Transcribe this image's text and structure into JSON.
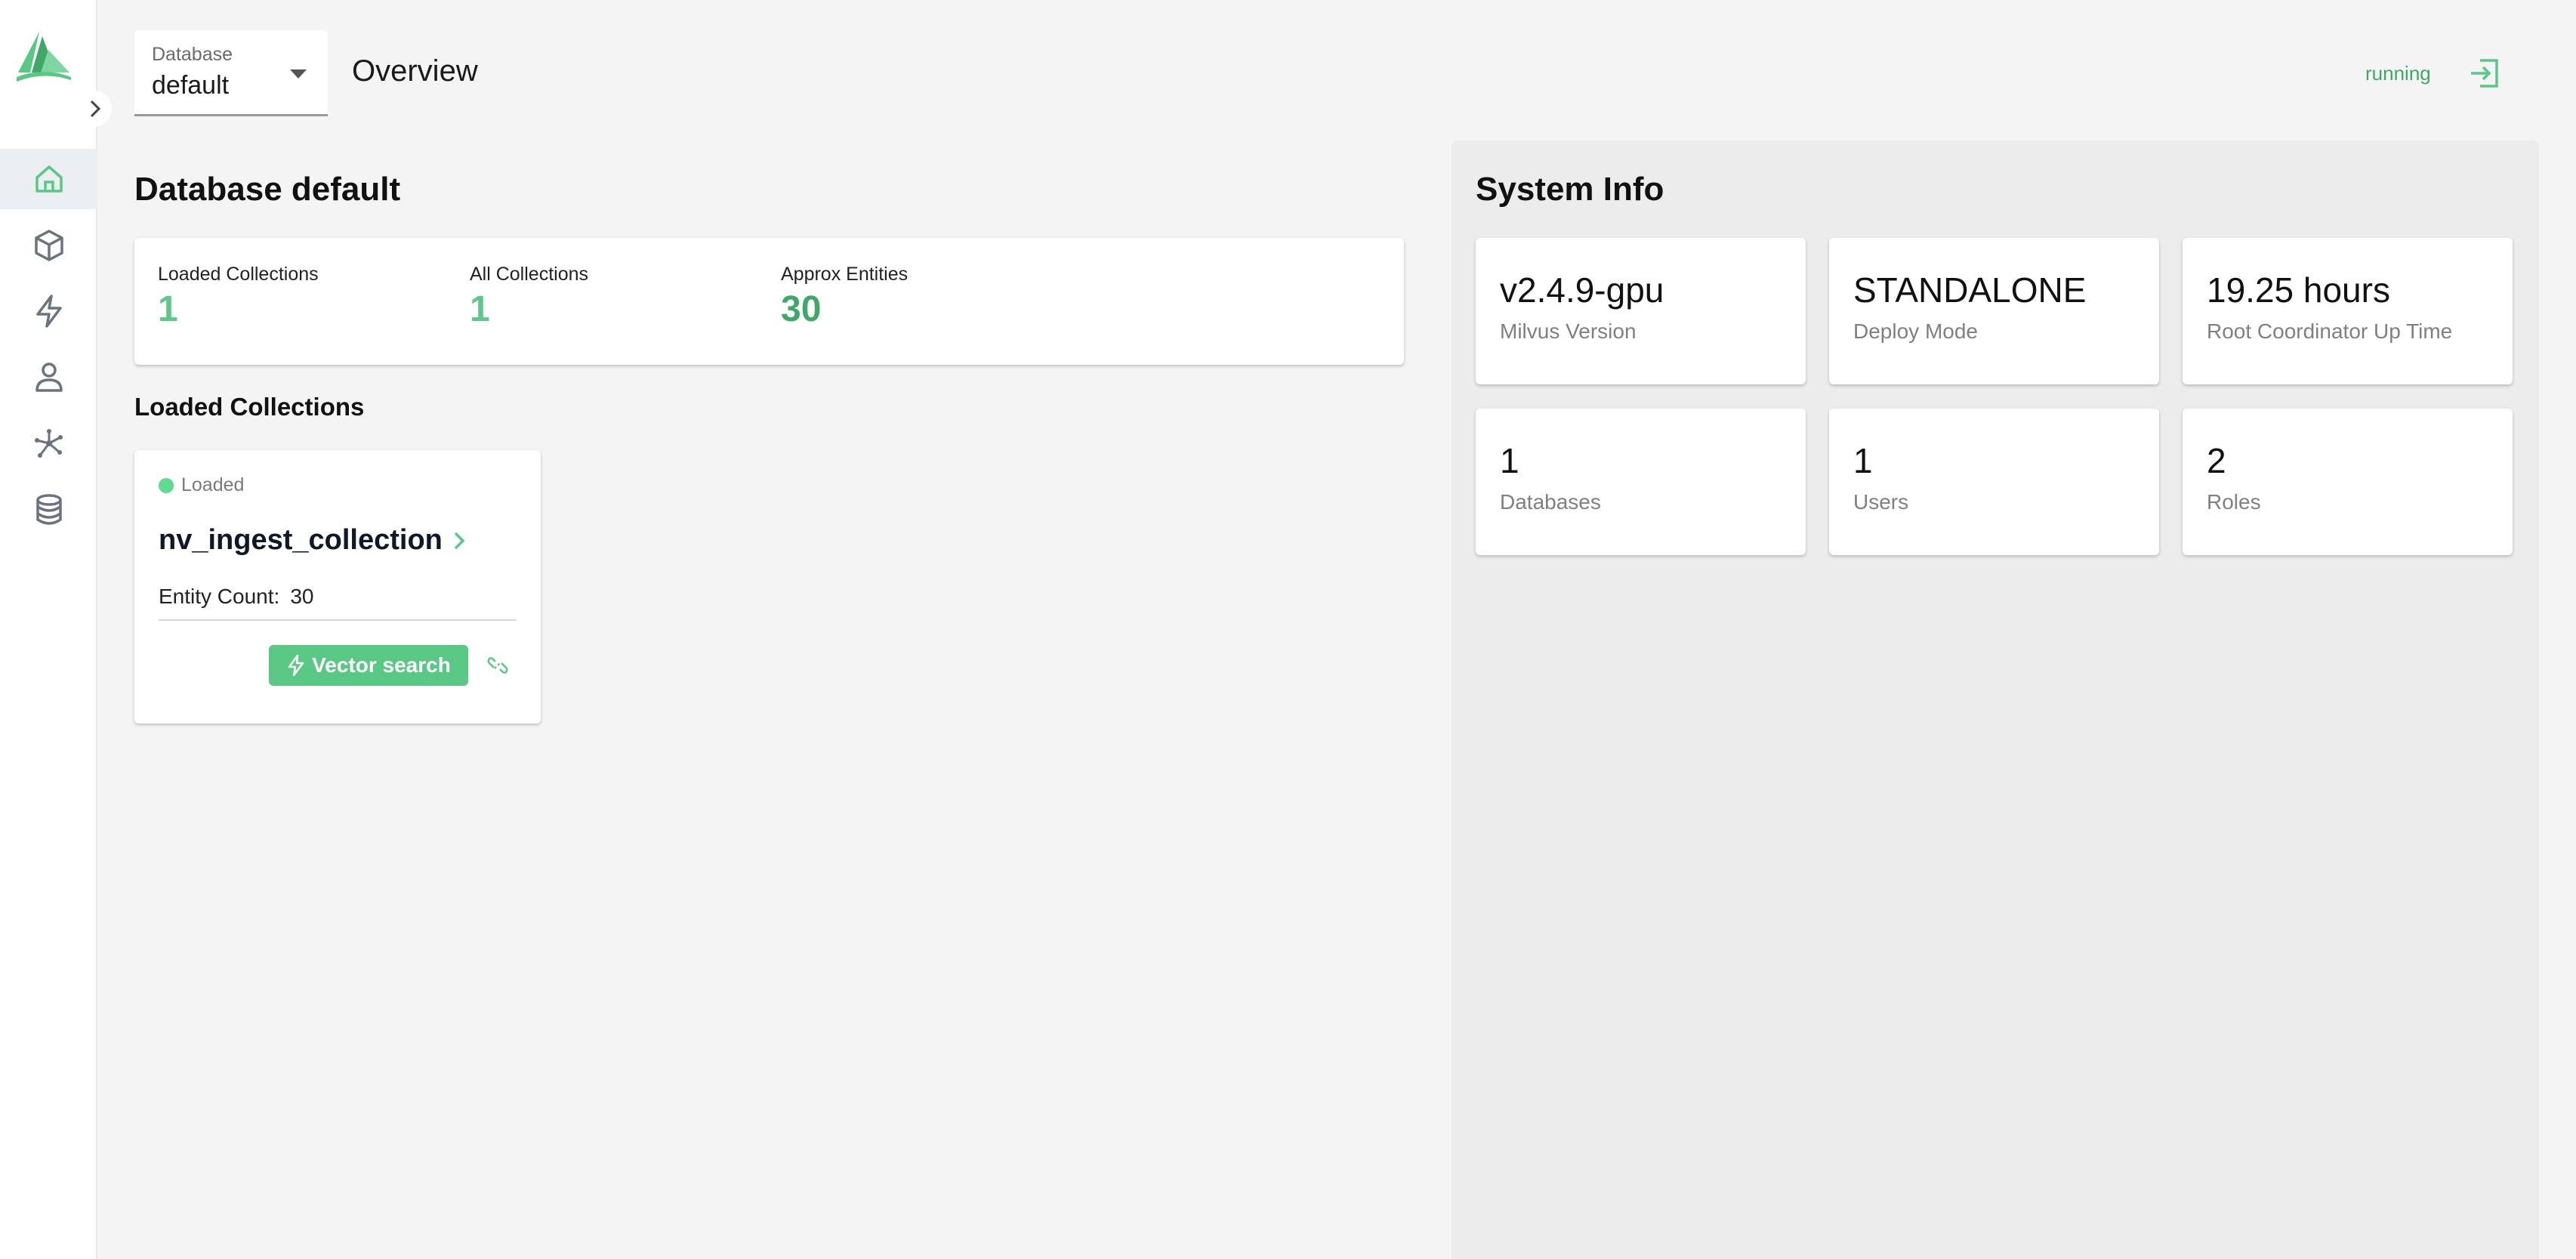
{
  "top_bar": {
    "database_label": "Database",
    "database_value": "default",
    "page_title": "Overview",
    "status": "running"
  },
  "database_section": {
    "title": "Database default",
    "stats": [
      {
        "label": "Loaded Collections",
        "value": "1"
      },
      {
        "label": "All Collections",
        "value": "1"
      },
      {
        "label": "Approx Entities",
        "value": "30"
      }
    ]
  },
  "loaded_collections": {
    "title": "Loaded Collections",
    "items": [
      {
        "status": "Loaded",
        "name": "nv_ingest_collection",
        "entity_count_label": "Entity Count:",
        "entity_count": "30",
        "action_label": "Vector search"
      }
    ]
  },
  "system_info": {
    "title": "System Info",
    "cards": [
      {
        "value": "v2.4.9-gpu",
        "label": "Milvus Version"
      },
      {
        "value": "STANDALONE",
        "label": "Deploy Mode"
      },
      {
        "value": "19.25 hours",
        "label": "Root Coordinator Up Time"
      },
      {
        "value": "1",
        "label": "Databases"
      },
      {
        "value": "1",
        "label": "Users"
      },
      {
        "value": "2",
        "label": "Roles"
      }
    ]
  },
  "colors": {
    "accent": "#5ac885",
    "accent_dark": "#3fa866",
    "icon_gray": "#6b7280"
  },
  "sidebar_icons": [
    "home-icon",
    "box-icon",
    "lightning-icon",
    "user-icon",
    "network-icon",
    "database-icon"
  ]
}
